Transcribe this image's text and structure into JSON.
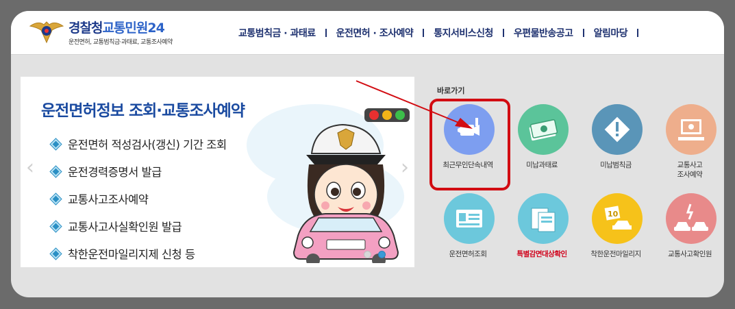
{
  "header": {
    "logo_main_a": "경찰청",
    "logo_main_b": "교통민원24",
    "logo_sub": "운전면허, 교통범칙금·과태료, 교통조사예약",
    "nav": [
      {
        "label": "교통범칙금 · 과태료"
      },
      {
        "label": "운전면허 · 조사예약"
      },
      {
        "label": "통지서비스신청"
      },
      {
        "label": "우편물반송공고"
      },
      {
        "label": "알림마당"
      }
    ]
  },
  "slider": {
    "title": "운전면허정보 조회·교통조사예약",
    "items": [
      "운전면허 적성검사(갱신) 기간 조회",
      "운전경력증명서 발급",
      "교통사고조사예약",
      "교통사고사실확인원 발급",
      "착한운전마일리지제 신청 등"
    ],
    "prev": "‹",
    "next": "›",
    "page_count": 2,
    "active_page": 2
  },
  "quick": {
    "label": "바로가기",
    "tiles": [
      {
        "label": "최근무인단속내역",
        "color": "#7d9ef0",
        "icon": "cctv-camera-icon",
        "highlighted": true
      },
      {
        "label": "미납과태료",
        "color": "#5bc49a",
        "icon": "money-bills-icon"
      },
      {
        "label": "미납범칙금",
        "color": "#5a95b8",
        "icon": "warning-diamond-icon"
      },
      {
        "label": "교통사고\n조사예약",
        "color": "#eeae8c",
        "icon": "computer-monitor-icon"
      },
      {
        "label": "운전면허조회",
        "color": "#6cc8dc",
        "icon": "id-card-icon"
      },
      {
        "label": "특별감면대상확인",
        "color": "#6cc8dc",
        "icon": "documents-icon",
        "emphasis": true
      },
      {
        "label": "착한운전마일리지",
        "color": "#f6c21a",
        "icon": "mileage-car-icon"
      },
      {
        "label": "교통사고확인원",
        "color": "#e88a8a",
        "icon": "car-crash-icon"
      }
    ]
  },
  "colors": {
    "brand_navy": "#1f3270",
    "title_blue": "#1a4aa0",
    "highlight_red": "#d20c12"
  }
}
